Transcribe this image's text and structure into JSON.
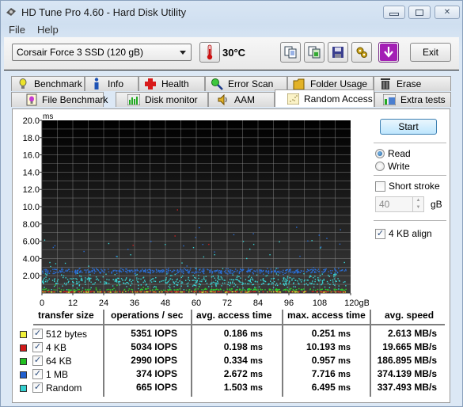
{
  "window": {
    "title": "HD Tune Pro 4.60 - Hard Disk Utility",
    "controls": {
      "minimize": "–",
      "maximize": "▢",
      "close": "✕"
    }
  },
  "menu": [
    {
      "label": "File",
      "accel": "F"
    },
    {
      "label": "Help",
      "accel": "H"
    }
  ],
  "toolbar": {
    "drive": "Corsair Force 3 SSD (120 gB)",
    "temperature": "30°C",
    "icons": [
      "copy-text-icon",
      "copy-image-icon",
      "save-icon",
      "options-icon",
      "download-icon"
    ],
    "exit_label": "Exit"
  },
  "tabs": {
    "row1": [
      {
        "label": "Benchmark",
        "icon": "lightbulb-icon"
      },
      {
        "label": "Info",
        "icon": "info-icon"
      },
      {
        "label": "Health",
        "icon": "health-cross-icon"
      },
      {
        "label": "Error Scan",
        "icon": "magnifier-icon"
      },
      {
        "label": "Folder Usage",
        "icon": "folder-icon"
      },
      {
        "label": "Erase",
        "icon": "trash-icon"
      }
    ],
    "row2": [
      {
        "label": "File Benchmark",
        "icon": "file-benchmark-icon"
      },
      {
        "label": "Disk monitor",
        "icon": "disk-monitor-icon"
      },
      {
        "label": "AAM",
        "icon": "speaker-icon"
      },
      {
        "label": "Random Access",
        "icon": "random-access-icon",
        "active": true
      },
      {
        "label": "Extra tests",
        "icon": "extra-tests-icon"
      }
    ]
  },
  "side": {
    "start_label": "Start",
    "read_label": "Read",
    "write_label": "Write",
    "mode": "Read",
    "short_stroke_label": "Short stroke",
    "short_stroke_checked": false,
    "short_stroke_value": "40",
    "short_stroke_unit": "gB",
    "align_label": "4 KB align",
    "align_checked": true
  },
  "chart_data": {
    "type": "scatter",
    "title": "",
    "ylabel": "ms",
    "xlabel": "gB",
    "ylim": [
      0,
      20
    ],
    "xlim": [
      0,
      120
    ],
    "yticks": [
      "20.0",
      "18.0",
      "16.0",
      "14.0",
      "12.0",
      "10.0",
      "8.00",
      "6.00",
      "4.00",
      "2.00"
    ],
    "ytick_values": [
      20,
      18,
      16,
      14,
      12,
      10,
      8,
      6,
      4,
      2
    ],
    "xticks": [
      "0",
      "12",
      "24",
      "36",
      "48",
      "60",
      "72",
      "84",
      "96",
      "108",
      "120gB"
    ],
    "xtick_values": [
      0,
      12,
      24,
      36,
      48,
      60,
      72,
      84,
      96,
      108,
      120
    ],
    "grid": true,
    "background": "#1a1a1a",
    "series": [
      {
        "name": "512 bytes",
        "color": "#e8e82a",
        "avg_ms": 0.186,
        "max_ms": 0.251
      },
      {
        "name": "4 KB",
        "color": "#d42020",
        "avg_ms": 0.198,
        "max_ms": 10.193
      },
      {
        "name": "64 KB",
        "color": "#2ed12e",
        "avg_ms": 0.334,
        "max_ms": 0.957
      },
      {
        "name": "1 MB",
        "color": "#2a6fd8",
        "avg_ms": 2.672,
        "max_ms": 7.716
      },
      {
        "name": "Random",
        "color": "#38d6d6",
        "avg_ms": 1.503,
        "max_ms": 6.495
      }
    ]
  },
  "results": {
    "headers": [
      "transfer size",
      "operations / sec",
      "avg. access time",
      "max. access time",
      "avg. speed"
    ],
    "rows": [
      {
        "color": "#f2f23a",
        "name": "512 bytes",
        "checked": true,
        "ops": "5351 IOPS",
        "avg": "0.186",
        "max": "0.251",
        "speed": "2.613 MB/s"
      },
      {
        "color": "#d11a1a",
        "name": "4 KB",
        "checked": true,
        "ops": "5034 IOPS",
        "avg": "0.198",
        "max": "10.193",
        "speed": "19.665 MB/s"
      },
      {
        "color": "#22c022",
        "name": "64 KB",
        "checked": true,
        "ops": "2990 IOPS",
        "avg": "0.334",
        "max": "0.957",
        "speed": "186.895 MB/s"
      },
      {
        "color": "#1f5fcf",
        "name": "1 MB",
        "checked": true,
        "ops": "374 IOPS",
        "avg": "2.672",
        "max": "7.716",
        "speed": "374.139 MB/s"
      },
      {
        "color": "#33d0d0",
        "name": "Random",
        "checked": true,
        "ops": "665 IOPS",
        "avg": "1.503",
        "max": "6.495",
        "speed": "337.493 MB/s"
      }
    ],
    "ms_unit": "ms"
  }
}
